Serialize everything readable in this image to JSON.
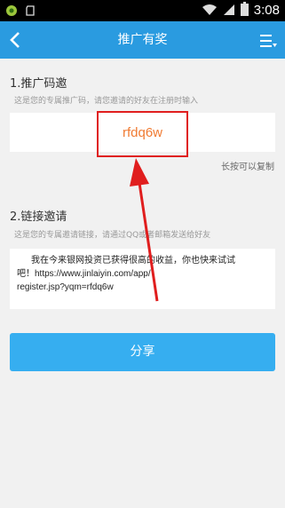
{
  "status_bar": {
    "time": "3:08",
    "icons": [
      "notification-icon",
      "clipboard-icon",
      "wifi-icon",
      "signal-icon",
      "battery-icon"
    ]
  },
  "header": {
    "title": "推广有奖",
    "back_icon": "chevron-left-icon",
    "menu_icon": "menu-icon"
  },
  "referral_code": {
    "heading": "1.推广码邀",
    "description": "这是您的专属推广码，请您邀请的好友在注册时输入",
    "code": "rfdq6w",
    "copy_hint": "长按可以复制"
  },
  "invite_link": {
    "heading": "2.链接邀请",
    "description": "这是您的专属邀请链接，请通过QQ或者邮箱发送给好友",
    "message_lines": [
      "我在今来银网投资已获得很高的收益，你也快来试试",
      "吧！https://www.jinlaiyin.com/app/",
      "register.jsp?yqm=rfdq6w"
    ]
  },
  "share_button": {
    "label": "分享"
  },
  "colors": {
    "header_bg": "#2a9be0",
    "button_bg": "#36aef0",
    "code_color": "#f07b33",
    "annotation_red": "#e01e1e",
    "page_bg": "#f1f1f1"
  }
}
